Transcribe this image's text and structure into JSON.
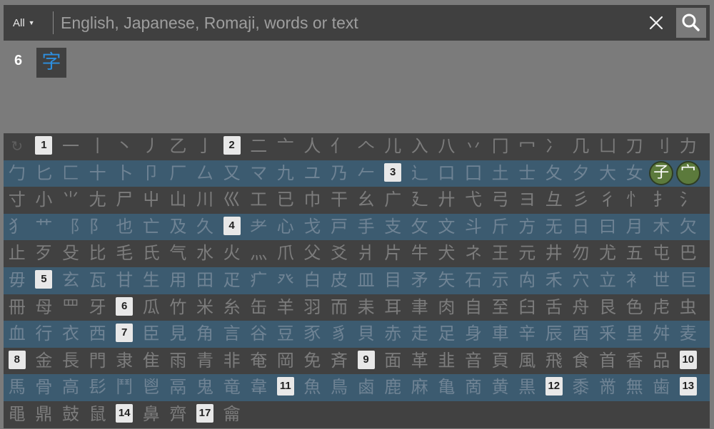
{
  "search": {
    "scope_label": "All",
    "placeholder": "English, Japanese, Romaji, words or text",
    "value": ""
  },
  "results": {
    "count": "6",
    "kanji": [
      "字"
    ]
  },
  "radicals": {
    "rows": [
      [
        "↻",
        "#1",
        "一",
        "丨",
        "丶",
        "丿",
        "乙",
        "亅",
        "#2",
        "二",
        "亠",
        "人",
        "亻",
        "𠆢",
        "儿",
        "入",
        "八",
        "丷",
        "冂",
        "冖",
        "冫",
        "几",
        "凵",
        "刀",
        "刂",
        "力"
      ],
      [
        "勹",
        "匕",
        "匚",
        "十",
        "卜",
        "卩",
        "厂",
        "厶",
        "又",
        "マ",
        "九",
        "ユ",
        "乃",
        "𠂉",
        "#3",
        "⻌",
        "口",
        "囗",
        "土",
        "士",
        "夂",
        "夕",
        "大",
        "女",
        "*子",
        "*宀"
      ],
      [
        "寸",
        "小",
        "⺌",
        "尢",
        "尸",
        "屮",
        "山",
        "川",
        "巛",
        "工",
        "已",
        "巾",
        "干",
        "幺",
        "广",
        "廴",
        "廾",
        "弋",
        "弓",
        "ヨ",
        "彑",
        "彡",
        "彳",
        "忄",
        "扌",
        "氵"
      ],
      [
        "犭",
        "艹",
        "⻏",
        "阝",
        "也",
        "亡",
        "及",
        "久",
        "#4",
        "耂",
        "心",
        "戈",
        "戸",
        "手",
        "支",
        "攵",
        "文",
        "斗",
        "斤",
        "方",
        "无",
        "日",
        "曰",
        "月",
        "木",
        "欠"
      ],
      [
        "止",
        "歹",
        "殳",
        "比",
        "毛",
        "氏",
        "气",
        "水",
        "火",
        "灬",
        "爪",
        "父",
        "爻",
        "爿",
        "片",
        "牛",
        "犬",
        "ネ",
        "王",
        "元",
        "井",
        "勿",
        "尤",
        "五",
        "屯",
        "巴"
      ],
      [
        "毋",
        "#5",
        "玄",
        "瓦",
        "甘",
        "生",
        "用",
        "田",
        "疋",
        "疒",
        "癶",
        "白",
        "皮",
        "皿",
        "目",
        "矛",
        "矢",
        "石",
        "示",
        "禸",
        "禾",
        "穴",
        "立",
        "衤",
        "世",
        "巨"
      ],
      [
        "冊",
        "母",
        "罒",
        "牙",
        "#6",
        "瓜",
        "竹",
        "米",
        "糸",
        "缶",
        "羊",
        "羽",
        "而",
        "耒",
        "耳",
        "聿",
        "肉",
        "自",
        "至",
        "臼",
        "舌",
        "舟",
        "艮",
        "色",
        "虍",
        "虫"
      ],
      [
        "血",
        "行",
        "衣",
        "西",
        "#7",
        "臣",
        "見",
        "角",
        "言",
        "谷",
        "豆",
        "豕",
        "豸",
        "貝",
        "赤",
        "走",
        "足",
        "身",
        "車",
        "辛",
        "辰",
        "酉",
        "釆",
        "里",
        "舛",
        "麦"
      ],
      [
        "#8",
        "金",
        "長",
        "門",
        "隶",
        "隹",
        "雨",
        "青",
        "非",
        "奄",
        "岡",
        "免",
        "斉",
        "#9",
        "面",
        "革",
        "韭",
        "音",
        "頁",
        "風",
        "飛",
        "食",
        "首",
        "香",
        "品",
        "#10"
      ],
      [
        "馬",
        "骨",
        "高",
        "髟",
        "鬥",
        "鬯",
        "鬲",
        "鬼",
        "竜",
        "韋",
        "#11",
        "魚",
        "鳥",
        "鹵",
        "鹿",
        "麻",
        "亀",
        "啇",
        "黄",
        "黒",
        "#12",
        "黍",
        "黹",
        "無",
        "歯",
        "#13"
      ],
      [
        "黽",
        "鼎",
        "鼓",
        "鼠",
        "#14",
        "鼻",
        "齊",
        "#17",
        "龠"
      ]
    ]
  },
  "colors": {
    "page_bg": "#7b7b7b",
    "bar_bg": "#404040",
    "row_dark": "#414141",
    "row_blue": "#3c5b70",
    "kanji_link": "#2d8fe0",
    "selected_radical": "#5c7a3c"
  },
  "icons": {
    "clear": "close-icon",
    "search": "search-icon",
    "reset": "reset-icon",
    "dropdown": "caret-down-icon"
  }
}
